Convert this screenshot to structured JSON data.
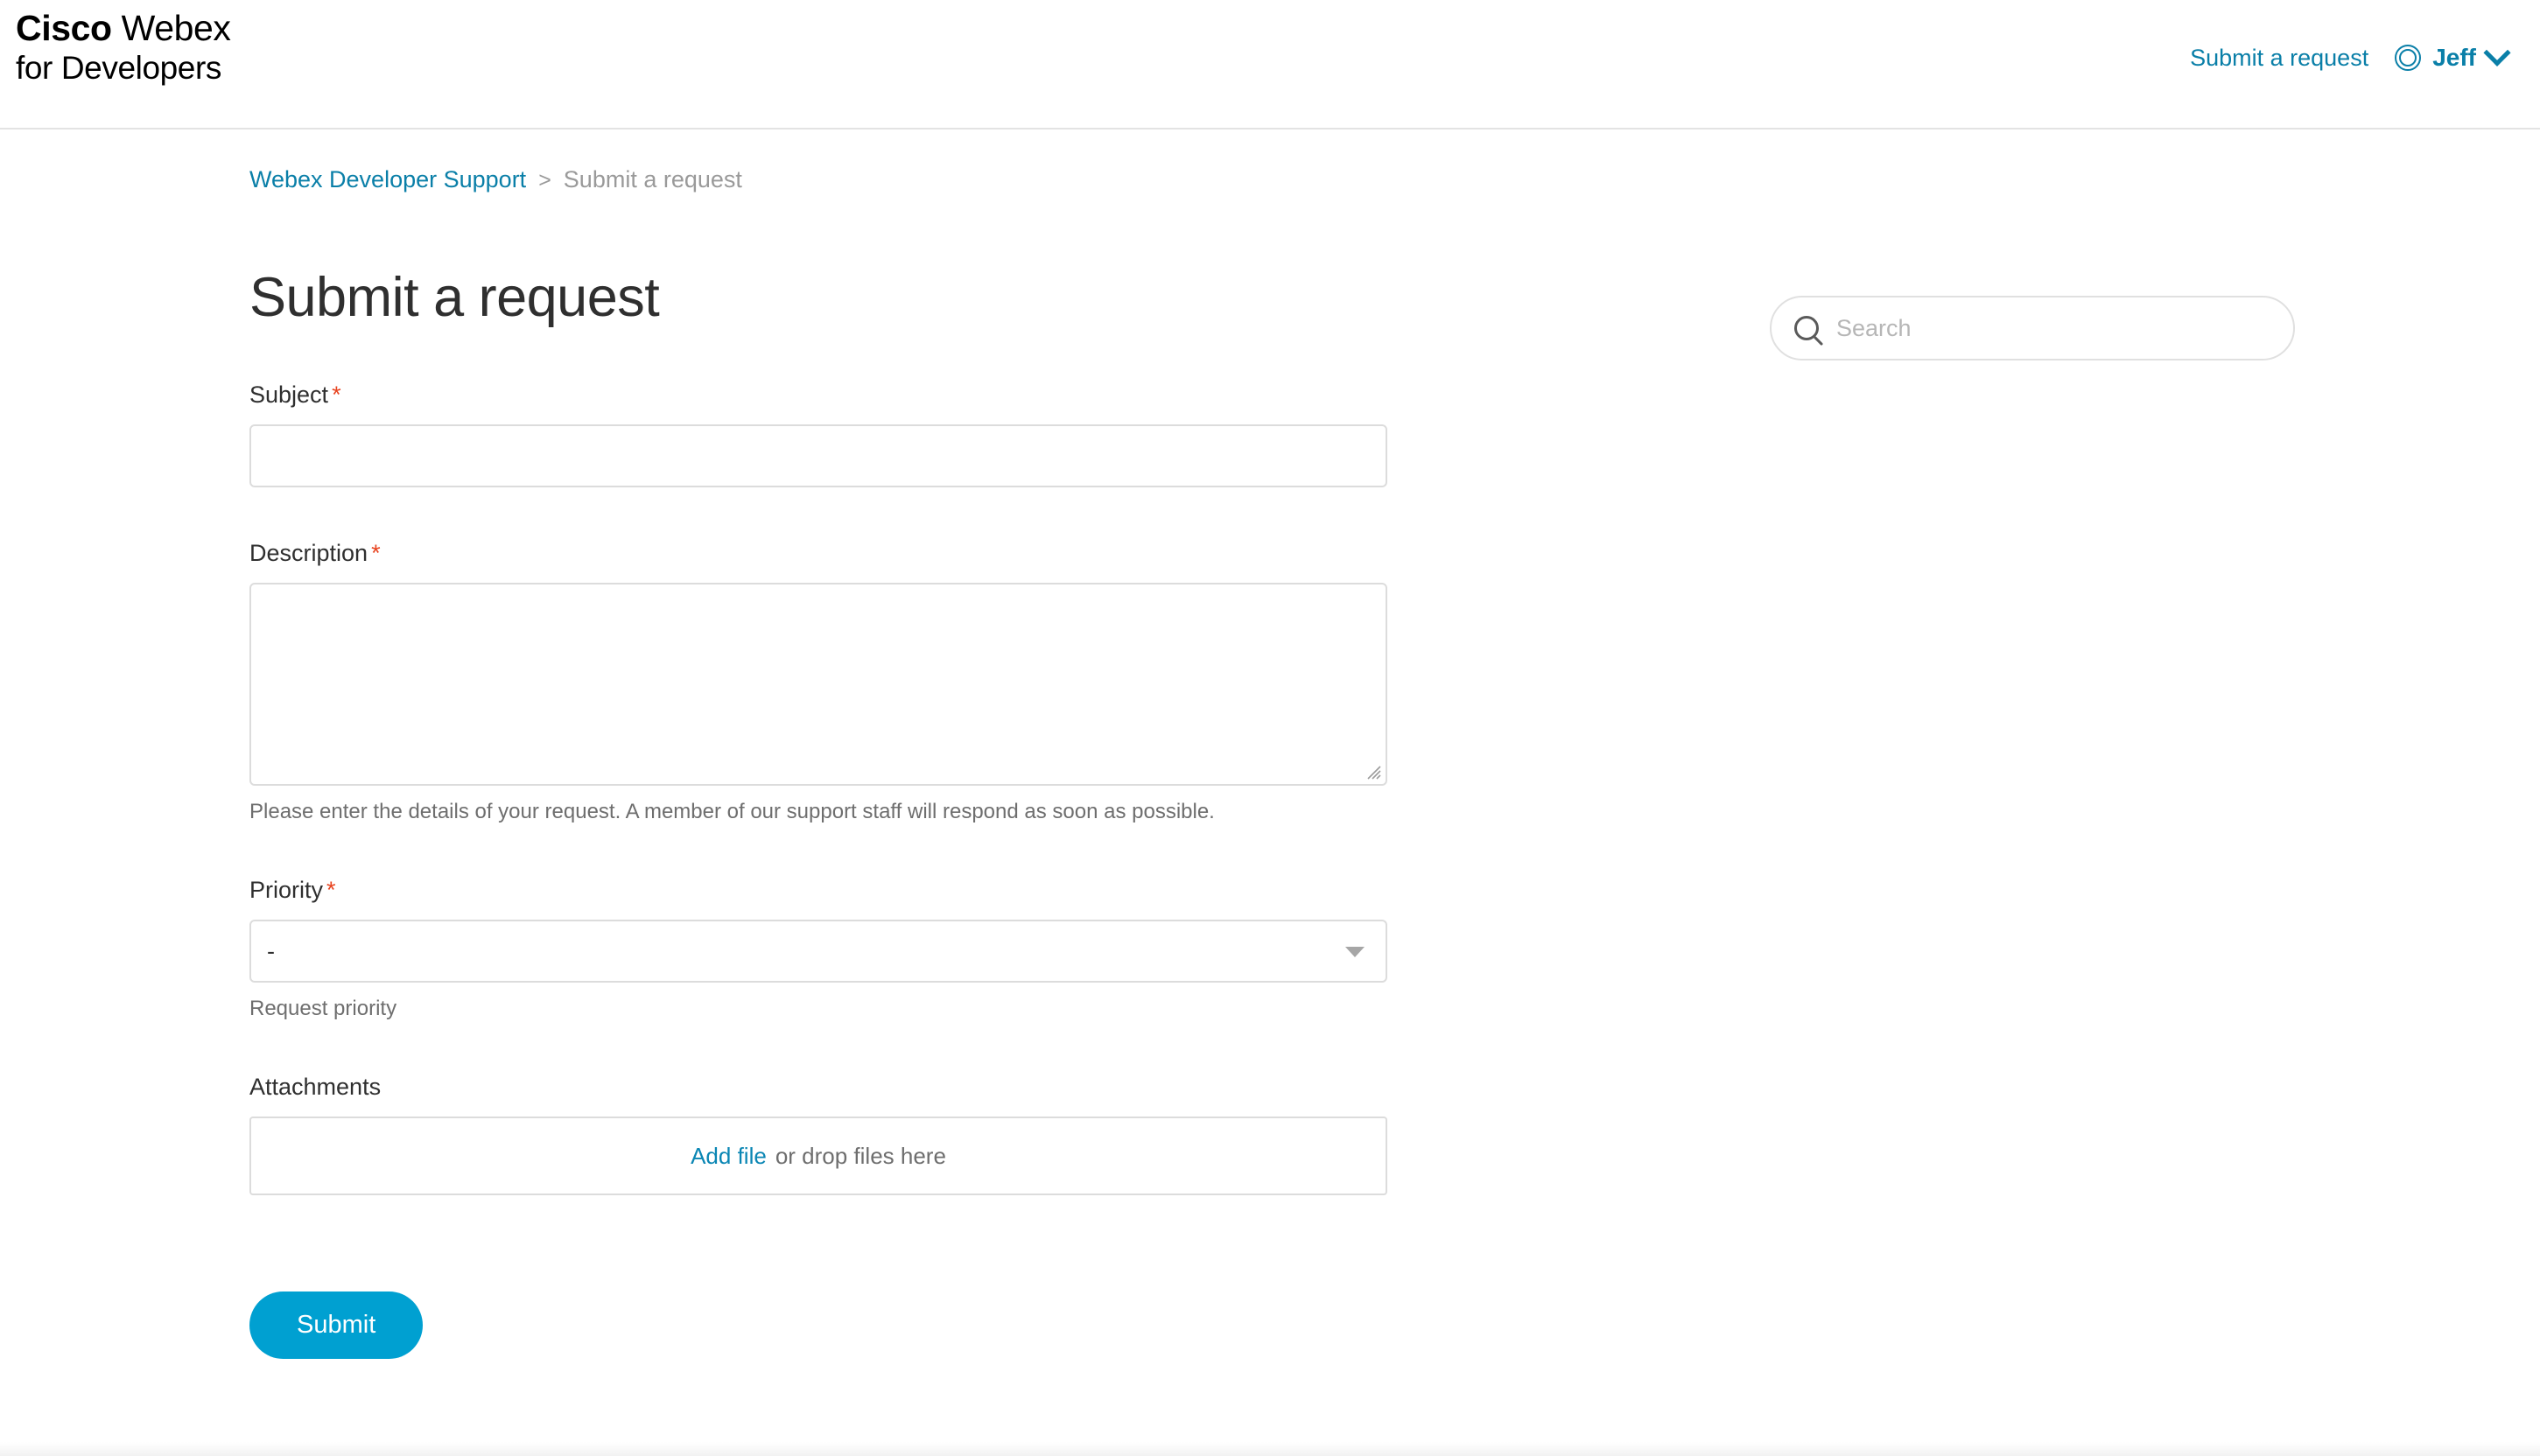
{
  "header": {
    "logo_line1_bold": "Cisco",
    "logo_line1_rest": " Webex",
    "logo_line2": "for Developers",
    "submit_request_link": "Submit a request",
    "user_name": "Jeff"
  },
  "breadcrumb": {
    "parent": "Webex Developer Support",
    "separator": ">",
    "current": "Submit a request"
  },
  "search": {
    "placeholder": "Search",
    "value": ""
  },
  "main": {
    "title": "Submit a request",
    "required_mark": "*",
    "fields": {
      "subject": {
        "label": "Subject",
        "value": ""
      },
      "description": {
        "label": "Description",
        "value": "",
        "hint": "Please enter the details of your request. A member of our support staff will respond as soon as possible."
      },
      "priority": {
        "label": "Priority",
        "selected": "-",
        "hint": "Request priority",
        "options": [
          "-"
        ]
      },
      "attachments": {
        "label": "Attachments",
        "add_file_link": "Add file",
        "drop_text": "or drop files here"
      }
    },
    "submit_label": "Submit"
  },
  "colors": {
    "link_blue": "#0a7fa8",
    "accent_blue": "#00a0d1",
    "required_red": "#e8431f",
    "border_gray": "#dcdcdc"
  }
}
